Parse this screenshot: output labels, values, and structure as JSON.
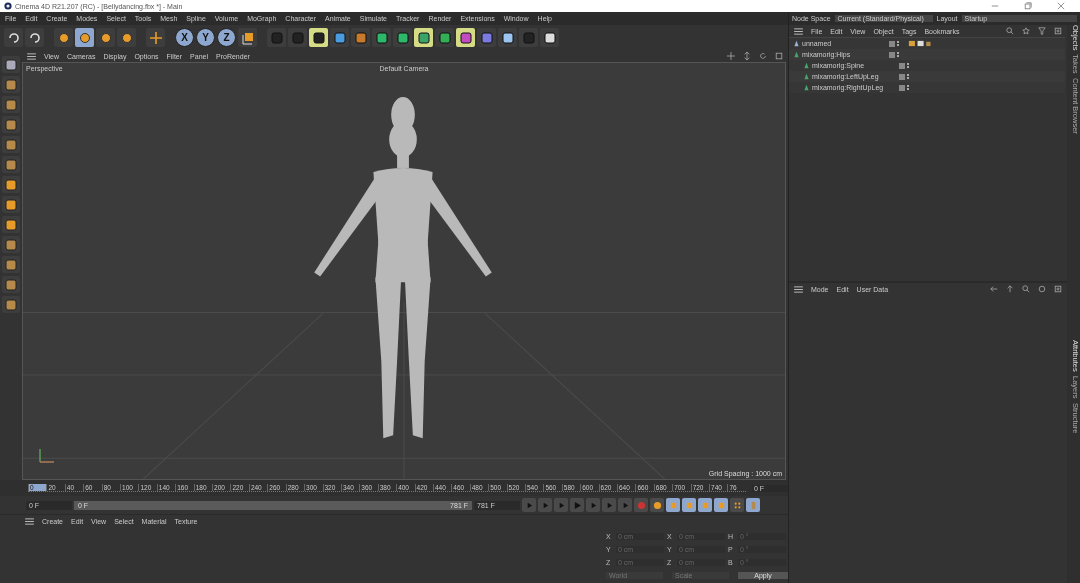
{
  "window": {
    "title": "Cinema 4D R21.207 (RC) - [Bellydancing.fbx *] - Main"
  },
  "menu": [
    "File",
    "Edit",
    "Create",
    "Modes",
    "Select",
    "Tools",
    "Mesh",
    "Spline",
    "Volume",
    "MoGraph",
    "Character",
    "Animate",
    "Simulate",
    "Tracker",
    "Render",
    "Extensions",
    "Window",
    "Help"
  ],
  "node_space": {
    "label": "Node Space",
    "value": "Current (Standard/Physical)"
  },
  "layout": {
    "label": "Layout",
    "value": "Startup"
  },
  "toolbar": {
    "axis_buttons": [
      "X",
      "Y",
      "Z"
    ]
  },
  "viewport": {
    "menu": [
      "View",
      "Cameras",
      "Display",
      "Options",
      "Filter",
      "Panel",
      "ProRender"
    ],
    "view_name": "Perspective",
    "camera": "Default Camera",
    "grid_spacing": "Grid Spacing : 1000 cm"
  },
  "timeline": {
    "ticks": [
      "0",
      "20",
      "40",
      "60",
      "80",
      "100",
      "120",
      "140",
      "160",
      "180",
      "200",
      "220",
      "240",
      "260",
      "280",
      "300",
      "320",
      "340",
      "360",
      "380",
      "400",
      "420",
      "440",
      "460",
      "480",
      "500",
      "520",
      "540",
      "560",
      "580",
      "600",
      "620",
      "640",
      "660",
      "680",
      "700",
      "720",
      "740",
      "76"
    ],
    "current_frame": "0 F",
    "start": "0 F",
    "range": {
      "start": "0 F",
      "end": "781 F",
      "level": 1
    },
    "end": "781 F"
  },
  "materials": {
    "menu": [
      "Create",
      "Edit",
      "View",
      "Select",
      "Material",
      "Texture"
    ]
  },
  "coordinates": {
    "rows": [
      {
        "a": "X",
        "a_value": "0 cm",
        "b": "X",
        "b_value": "0 cm",
        "c": "H",
        "c_value": "0 °"
      },
      {
        "a": "Y",
        "a_value": "0 cm",
        "b": "Y",
        "b_value": "0 cm",
        "c": "P",
        "c_value": "0 °"
      },
      {
        "a": "Z",
        "a_value": "0 cm",
        "b": "Z",
        "b_value": "0 cm",
        "c": "B",
        "c_value": "0 °"
      }
    ],
    "mode": "World",
    "size_mode": "Scale",
    "apply": "Apply"
  },
  "objects": {
    "menu": [
      "File",
      "Edit",
      "View",
      "Object",
      "Tags",
      "Bookmarks"
    ],
    "tree": [
      {
        "name": "unnamed",
        "kind": "null"
      },
      {
        "name": "mixamorig:Hips",
        "kind": "joint",
        "children": [
          {
            "name": "mixamorig:Spine",
            "kind": "joint"
          },
          {
            "name": "mixamorig:LeftUpLeg",
            "kind": "joint"
          },
          {
            "name": "mixamorig:RightUpLeg",
            "kind": "joint"
          }
        ]
      }
    ]
  },
  "attributes": {
    "menu": [
      "Mode",
      "Edit",
      "User Data"
    ]
  },
  "side_tabs_top": [
    "Objects",
    "Takes",
    "Content Browser"
  ],
  "side_tabs_bottom": [
    "Attributes",
    "Layers",
    "Structure"
  ]
}
